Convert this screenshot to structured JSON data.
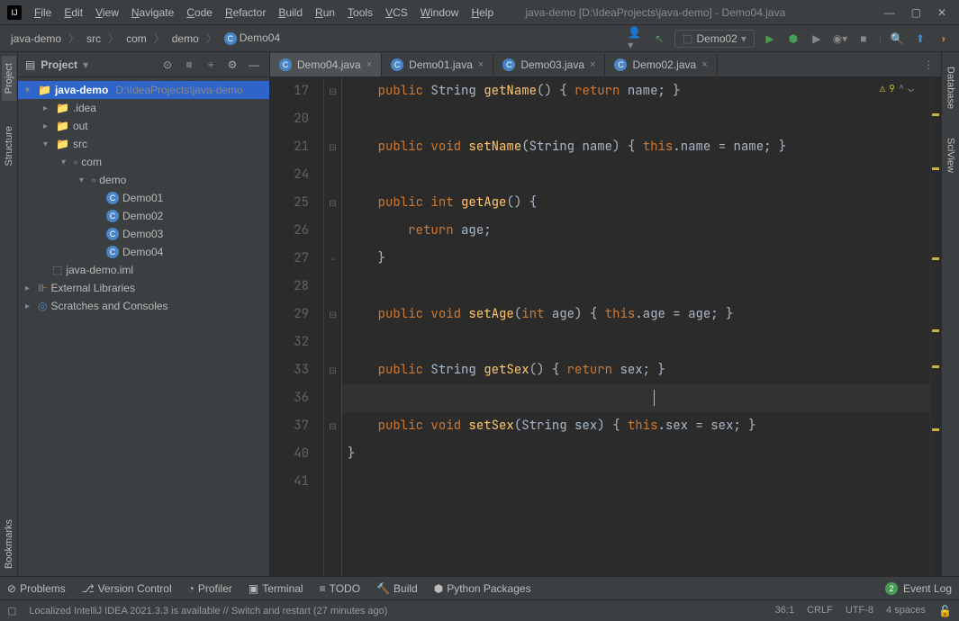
{
  "title": "java-demo [D:\\IdeaProjects\\java-demo] - Demo04.java",
  "menu": [
    "File",
    "Edit",
    "View",
    "Navigate",
    "Code",
    "Refactor",
    "Build",
    "Run",
    "Tools",
    "VCS",
    "Window",
    "Help"
  ],
  "breadcrumb": {
    "project": "java-demo",
    "parts": [
      "src",
      "com",
      "demo"
    ],
    "class": "Demo04"
  },
  "run_config": "Demo02",
  "project_panel": {
    "title": "Project",
    "root": {
      "name": "java-demo",
      "path": "D:\\IdeaProjects\\java-demo"
    },
    "nodes": {
      "idea": ".idea",
      "out": "out",
      "src": "src",
      "com": "com",
      "demo": "demo",
      "classes": [
        "Demo01",
        "Demo02",
        "Demo03",
        "Demo04"
      ],
      "iml": "java-demo.iml",
      "ext": "External Libraries",
      "scratch": "Scratches and Consoles"
    }
  },
  "tabs": [
    {
      "name": "Demo04.java",
      "active": true
    },
    {
      "name": "Demo01.java",
      "active": false
    },
    {
      "name": "Demo03.java",
      "active": false
    },
    {
      "name": "Demo02.java",
      "active": false
    }
  ],
  "code": {
    "lines": [
      {
        "n": 17,
        "fold": "-",
        "tokens": [
          [
            "    ",
            ""
          ],
          [
            "public ",
            "kw"
          ],
          [
            "String ",
            ""
          ],
          [
            "getName",
            "method"
          ],
          [
            "() ",
            ""
          ],
          [
            "{ ",
            "brace"
          ],
          [
            "return ",
            "kw"
          ],
          [
            "name",
            ""
          ],
          [
            "; ",
            ""
          ],
          [
            "}",
            "brace"
          ]
        ]
      },
      {
        "n": 20,
        "fold": "",
        "tokens": [
          [
            "",
            ""
          ]
        ]
      },
      {
        "n": 21,
        "fold": "-",
        "tokens": [
          [
            "    ",
            ""
          ],
          [
            "public ",
            "kw"
          ],
          [
            "void ",
            "kw"
          ],
          [
            "setName",
            "method"
          ],
          [
            "(",
            ""
          ],
          [
            "String ",
            ""
          ],
          [
            "name",
            ""
          ],
          [
            ") ",
            ""
          ],
          [
            "{ ",
            "brace"
          ],
          [
            "this",
            "kw"
          ],
          [
            ".name = name; ",
            ""
          ],
          [
            "}",
            "brace"
          ]
        ]
      },
      {
        "n": 24,
        "fold": "",
        "tokens": [
          [
            "",
            ""
          ]
        ]
      },
      {
        "n": 25,
        "fold": "-",
        "tokens": [
          [
            "    ",
            ""
          ],
          [
            "public ",
            "kw"
          ],
          [
            "int ",
            "kw"
          ],
          [
            "getAge",
            "method"
          ],
          [
            "() {",
            ""
          ]
        ]
      },
      {
        "n": 26,
        "fold": "",
        "tokens": [
          [
            "        ",
            ""
          ],
          [
            "return ",
            "kw"
          ],
          [
            "age;",
            ""
          ]
        ]
      },
      {
        "n": 27,
        "fold": "^",
        "tokens": [
          [
            "    }",
            ""
          ]
        ]
      },
      {
        "n": 28,
        "fold": "",
        "tokens": [
          [
            "",
            ""
          ]
        ]
      },
      {
        "n": 29,
        "fold": "-",
        "tokens": [
          [
            "    ",
            ""
          ],
          [
            "public ",
            "kw"
          ],
          [
            "void ",
            "kw"
          ],
          [
            "setAge",
            "method"
          ],
          [
            "(",
            ""
          ],
          [
            "int ",
            "kw"
          ],
          [
            "age",
            ""
          ],
          [
            ") ",
            ""
          ],
          [
            "{ ",
            "brace"
          ],
          [
            "this",
            "kw"
          ],
          [
            ".age = age; ",
            ""
          ],
          [
            "}",
            "brace"
          ]
        ]
      },
      {
        "n": 32,
        "fold": "",
        "tokens": [
          [
            "",
            ""
          ]
        ]
      },
      {
        "n": 33,
        "fold": "-",
        "tokens": [
          [
            "    ",
            ""
          ],
          [
            "public ",
            "kw"
          ],
          [
            "String ",
            ""
          ],
          [
            "getSex",
            "method"
          ],
          [
            "() ",
            ""
          ],
          [
            "{ ",
            "brace"
          ],
          [
            "return ",
            "kw"
          ],
          [
            "sex",
            ""
          ],
          [
            "; ",
            ""
          ],
          [
            "}",
            "brace"
          ]
        ]
      },
      {
        "n": 36,
        "fold": "",
        "current": true,
        "tokens": [
          [
            "",
            ""
          ]
        ]
      },
      {
        "n": 37,
        "fold": "-",
        "tokens": [
          [
            "    ",
            ""
          ],
          [
            "public ",
            "kw"
          ],
          [
            "void ",
            "kw"
          ],
          [
            "setSex",
            "method"
          ],
          [
            "(",
            ""
          ],
          [
            "String ",
            ""
          ],
          [
            "sex",
            ""
          ],
          [
            ") ",
            ""
          ],
          [
            "{ ",
            "brace"
          ],
          [
            "this",
            "kw"
          ],
          [
            ".sex = sex; ",
            ""
          ],
          [
            "}",
            "brace"
          ]
        ]
      },
      {
        "n": 40,
        "fold": "",
        "tokens": [
          [
            "}",
            ""
          ]
        ]
      },
      {
        "n": 41,
        "fold": "",
        "tokens": [
          [
            "",
            ""
          ]
        ]
      }
    ]
  },
  "warnings": "9",
  "bottom_tabs": [
    "Problems",
    "Version Control",
    "Profiler",
    "Terminal",
    "TODO",
    "Build",
    "Python Packages"
  ],
  "event_log": "Event Log",
  "status": {
    "msg": "Localized IntelliJ IDEA 2021.3.3 is available // Switch and restart (27 minutes ago)",
    "pos": "36:1",
    "sep": "CRLF",
    "enc": "UTF-8",
    "indent": "4 spaces"
  },
  "right_tools": [
    "Database",
    "SciView"
  ],
  "left_tools": [
    "Project",
    "Structure"
  ],
  "left_bottom": "Bookmarks"
}
